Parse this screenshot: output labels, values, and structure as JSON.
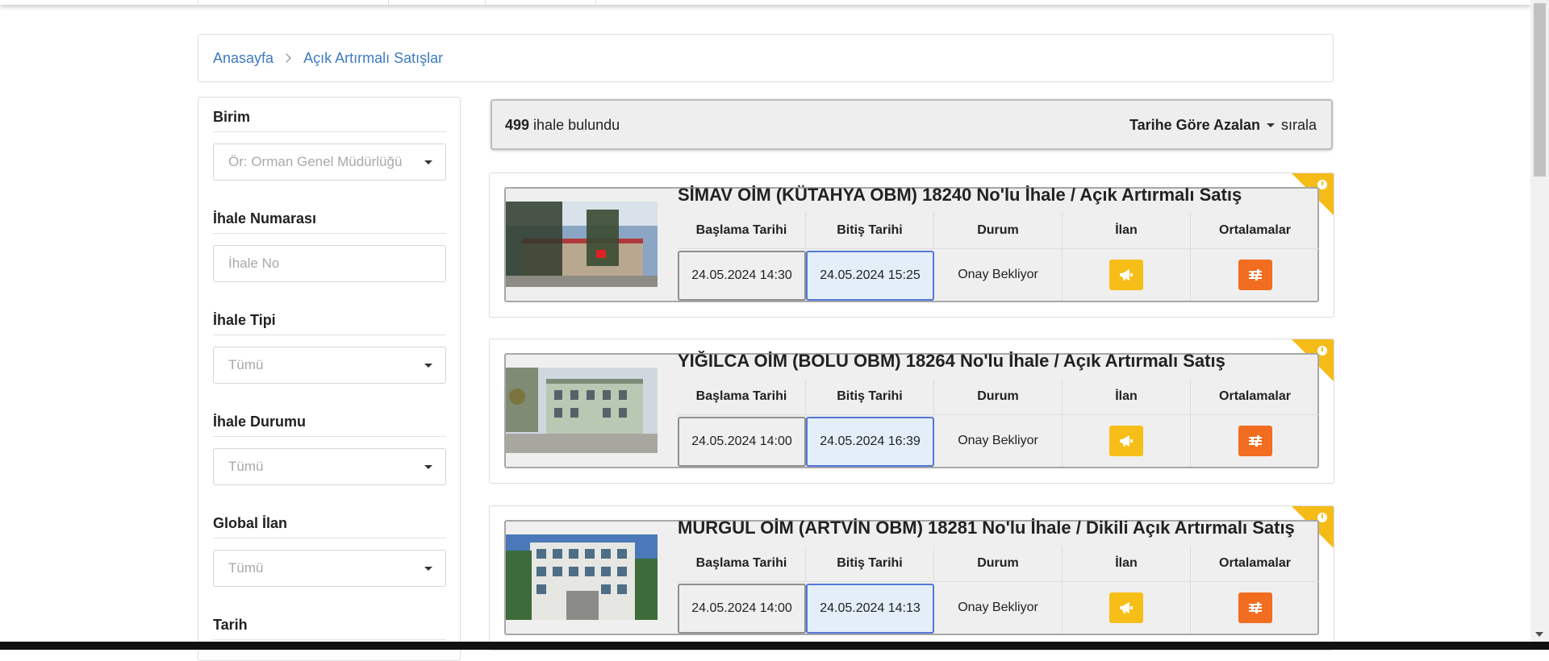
{
  "breadcrumb": {
    "home": "Anasayfa",
    "current": "Açık Artırmalı Satışlar"
  },
  "filters": {
    "birim": {
      "label": "Birim",
      "placeholder": "Ör: Orman Genel Müdürlüğü"
    },
    "ihale_no": {
      "label": "İhale Numarası",
      "placeholder": "İhale No"
    },
    "ihale_tipi": {
      "label": "İhale Tipi",
      "value": "Tümü"
    },
    "ihale_durumu": {
      "label": "İhale Durumu",
      "value": "Tümü"
    },
    "global_ilan": {
      "label": "Global İlan",
      "value": "Tümü"
    },
    "tarih": {
      "label": "Tarih"
    }
  },
  "results": {
    "count": "499",
    "count_suffix": " ihale bulundu",
    "sort_label": "Tarihe Göre Azalan",
    "sort_suffix": "sırala"
  },
  "table_headers": {
    "start": "Başlama Tarihi",
    "end": "Bitiş Tarihi",
    "status": "Durum",
    "notice": "İlan",
    "averages": "Ortalamalar"
  },
  "listings": [
    {
      "title": "SİMAV OİM (KÜTAHYA OBM) 18240 No'lu İhale / Açık Artırmalı Satış",
      "start": "24.05.2024 14:30",
      "end": "24.05.2024 15:25",
      "status": "Onay Bekliyor"
    },
    {
      "title": "YIĞILCA OİM (BOLU OBM) 18264 No'lu İhale / Açık Artırmalı Satış",
      "start": "24.05.2024 14:00",
      "end": "24.05.2024 16:39",
      "status": "Onay Bekliyor"
    },
    {
      "title": "MURGUL OİM (ARTVİN OBM) 18281 No'lu İhale / Dikili Açık Artırmalı Satış",
      "start": "24.05.2024 14:00",
      "end": "24.05.2024 14:13",
      "status": "Onay Bekliyor"
    }
  ],
  "colors": {
    "link": "#3e7bc1",
    "notice_button": "#f6be17",
    "averages_button": "#f26d1f",
    "corner_badge": "#f5bb17",
    "end_date_border": "#5677d6"
  },
  "icons": {
    "notice": "megaphone-icon",
    "averages": "sliders-icon",
    "corner": "clock-icon"
  }
}
